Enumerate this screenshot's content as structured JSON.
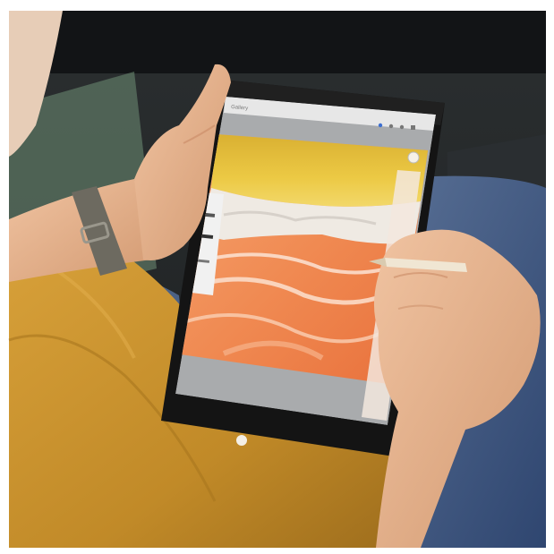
{
  "scene": {
    "subject": "person-drawing-on-tablet",
    "app": {
      "title": "Gallery",
      "toolbar_icons": [
        "brush-icon",
        "smudge-icon",
        "eraser-icon",
        "layers-icon",
        "color-icon"
      ],
      "side_tools": [
        "brush-size-slider",
        "undo-icon",
        "redo-icon",
        "opacity-slider"
      ]
    },
    "colors": {
      "shirt": "#c9922e",
      "jeans": "#3c5a86",
      "sky_yellow": "#e7c33a",
      "mountain_white": "#efeae3",
      "land_orange": "#f08a52",
      "tablet_frame": "#141414",
      "skin": "#e4b08c"
    }
  }
}
